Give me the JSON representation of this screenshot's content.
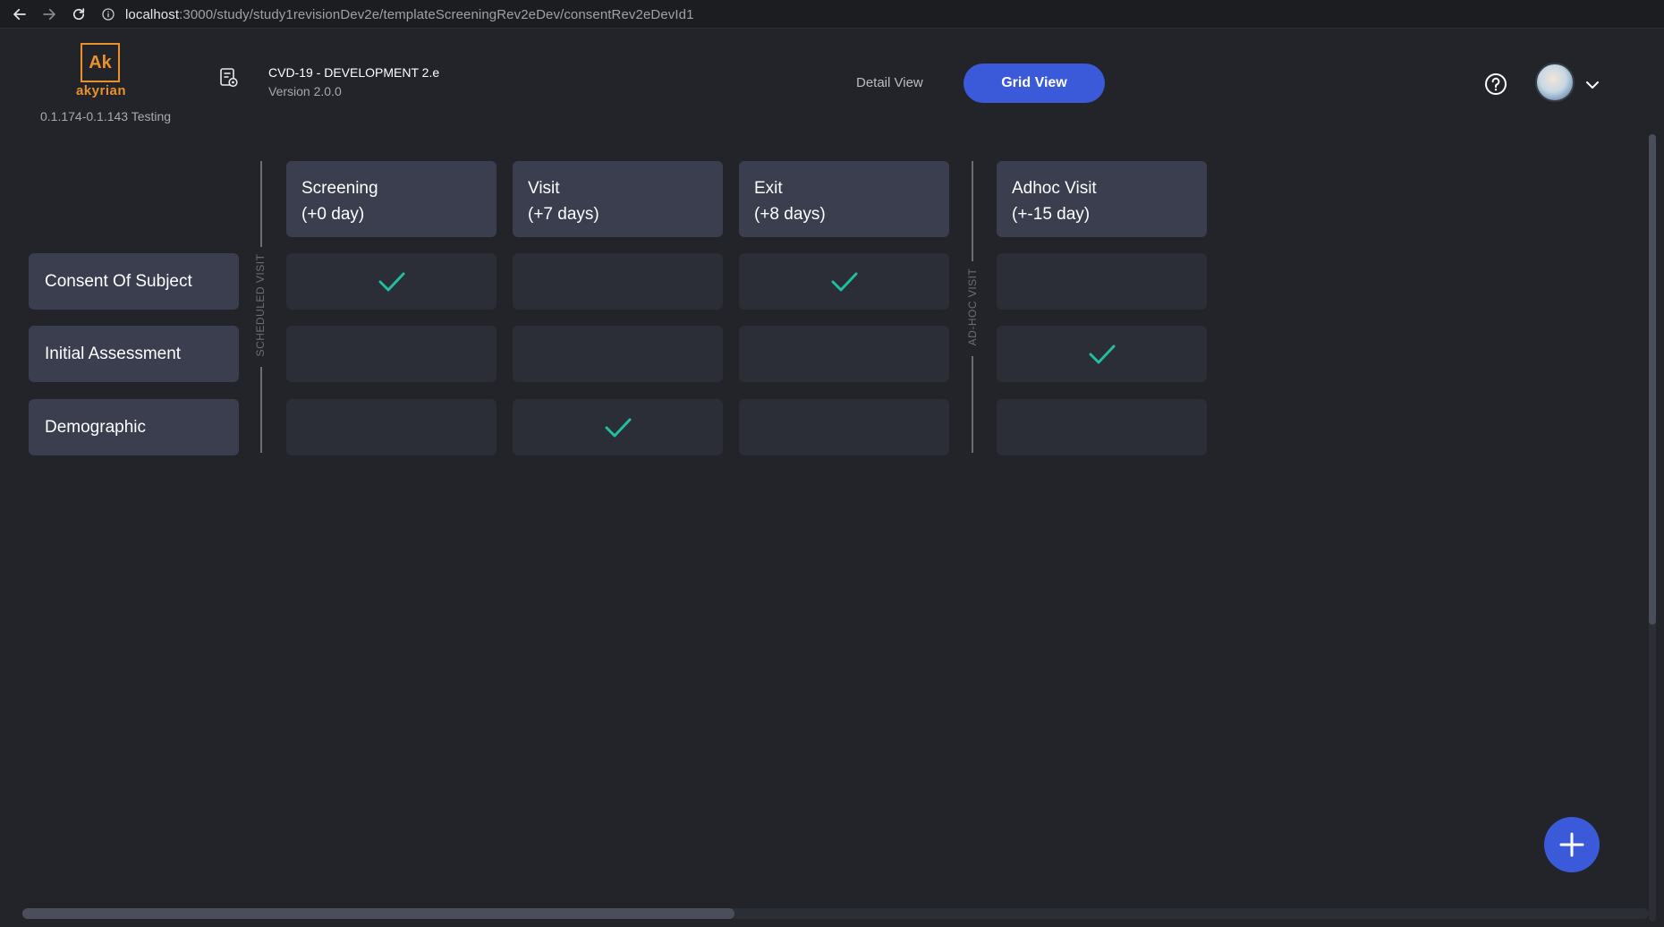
{
  "browser": {
    "url_host": "localhost",
    "url_rest": ":3000/study/study1revisionDev2e/templateScreeningRev2eDev/consentRev2eDevId1"
  },
  "app": {
    "logo_mark": "Ak",
    "logo_text": "akyrian",
    "version": "0.1.174-0.1.143 Testing"
  },
  "study": {
    "title": "CVD-19 - DEVELOPMENT 2.e",
    "version": "Version 2.0.0"
  },
  "view_toggle": {
    "detail_label": "Detail View",
    "grid_label": "Grid View",
    "active": "Grid View"
  },
  "grid": {
    "scheduled_label": "SCHEDULED VISIT",
    "adhoc_label": "AD-HOC VISIT",
    "columns": [
      {
        "name": "Screening",
        "offset": "(+0 day)"
      },
      {
        "name": "Visit",
        "offset": "(+7 days)"
      },
      {
        "name": "Exit",
        "offset": "(+8 days)"
      },
      {
        "name": "Adhoc Visit",
        "offset": "(+-15 day)"
      }
    ],
    "rows": [
      {
        "label": "Consent Of Subject",
        "checks": [
          true,
          false,
          true,
          false
        ]
      },
      {
        "label": "Initial Assessment",
        "checks": [
          false,
          false,
          false,
          true
        ]
      },
      {
        "label": "Demographic",
        "checks": [
          false,
          true,
          false,
          false
        ]
      }
    ]
  },
  "colors": {
    "accent": "#3b5ad9",
    "brand": "#e8912d",
    "check": "#1fbf9f",
    "background": "#22242a"
  }
}
